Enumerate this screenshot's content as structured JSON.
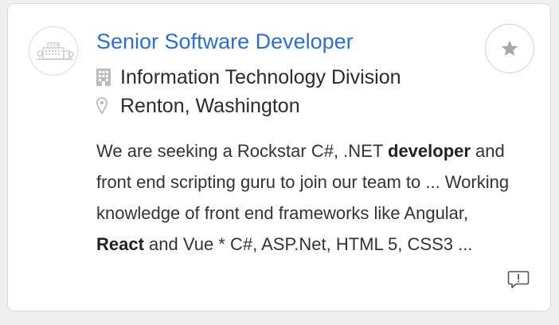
{
  "job": {
    "title": "Senior Software Developer",
    "department": "Information Technology Division",
    "location": "Renton, Washington",
    "description": [
      {
        "text": "We are seeking a Rockstar C#, .NET ",
        "bold": false
      },
      {
        "text": "developer",
        "bold": true
      },
      {
        "text": " and front end scripting guru to join our team to ... Working knowledge of front end frameworks like Angular, ",
        "bold": false
      },
      {
        "text": "React",
        "bold": true
      },
      {
        "text": " and Vue * C#, ASP.Net, HTML 5, CSS3 ...",
        "bold": false
      }
    ]
  },
  "icons": {
    "logo": "building-logo-icon",
    "department": "building-icon",
    "location": "map-pin-icon",
    "favorite": "star-icon",
    "feedback": "comment-alert-icon"
  },
  "colors": {
    "title": "#2f6fc6",
    "icon_gray": "#bdbdbd",
    "text": "#2b2b2b"
  }
}
